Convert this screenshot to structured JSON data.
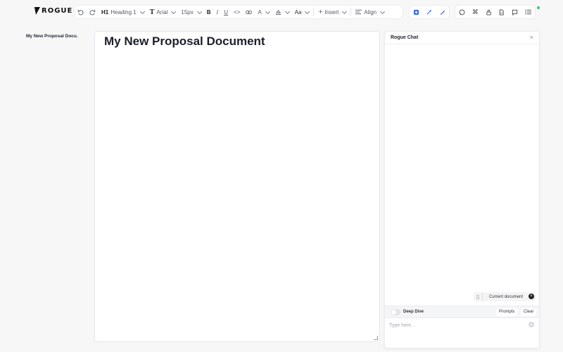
{
  "brand": {
    "name": "ROGUE"
  },
  "toolbar": {
    "heading_prefix": "H1",
    "heading_label": "Heading 1",
    "font_label": "Arial",
    "size_label": "15px",
    "bold": "B",
    "italic": "I",
    "underline": "U",
    "code": "<>",
    "link": "⊃",
    "text_color": "A",
    "case": "Aa",
    "insert_label": "Insert",
    "align_label": "Align",
    "icons": [
      "undo-icon",
      "redo-icon",
      "text-type-icon",
      "highlight-icon",
      "plus-icon",
      "align-icon",
      "ai-blue-icon",
      "magic-icon",
      "pen-icon",
      "chat-icon",
      "command-icon",
      "lock-icon",
      "document-icon",
      "comment-icon",
      "list-icon"
    ]
  },
  "sidebar": {
    "documents": [
      {
        "label": "My New Proposal Docu..."
      }
    ]
  },
  "editor": {
    "title": "My New Proposal Document"
  },
  "chat": {
    "title": "Rogue Chat",
    "context_chip": "Current document",
    "deep_dive_label": "Deep Dive",
    "prompts_label": "Prompts",
    "clear_label": "Clear",
    "input_placeholder": "Type here..."
  },
  "colors": {
    "background": "#f7f7f8",
    "status_online": "#2ecc71",
    "accent_blue": "#3b6fe0"
  }
}
